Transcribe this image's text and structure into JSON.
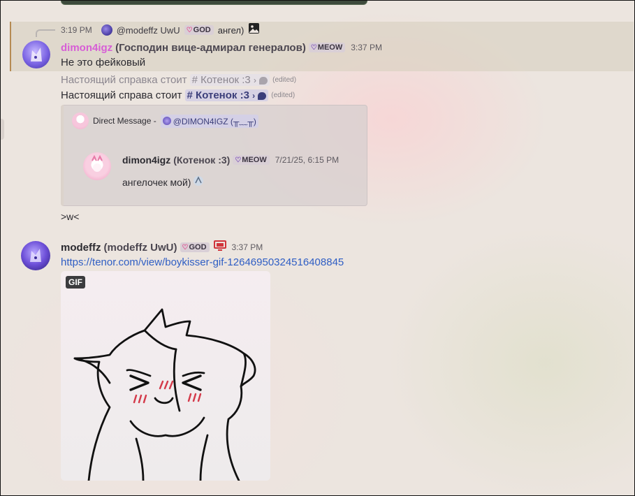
{
  "reply_header": {
    "time": "3:19 PM",
    "user": "@modeffz UwU",
    "badge": "GOD",
    "text": "ангел)",
    "image_icon": "image-icon"
  },
  "messages": {
    "dimon": {
      "username": "dimon4igz",
      "display": "(Господин вице-адмирал генералов)",
      "badge": "MEOW",
      "time": "3:37 PM",
      "text": "Не это фейковый",
      "username_color": "#d75ed6"
    },
    "edited_old": {
      "prefix": "Настоящий справка стоит",
      "channel": "Котенок :3",
      "chevron": "›",
      "edited": "(edited)"
    },
    "edited_new": {
      "prefix": "Настоящий справа стоит",
      "channel": "Котенок :3",
      "chevron": "›",
      "edited": "(edited)"
    },
    "forward": {
      "label": "Direct Message -",
      "mention": "@DIMON4IGZ (╥﹏╥)",
      "username": "dimon4igz",
      "display": "(Котенок :3)",
      "badge": "MEOW",
      "time": "7/21/25, 6:15 PM",
      "text": "ангелочек мой)"
    },
    "followup": {
      "text": ">w<"
    },
    "modeffz": {
      "username": "modeffz",
      "display": "(modeffz UwU)",
      "badge": "GOD",
      "device_icon": "monitor-icon",
      "time": "3:37 PM",
      "link": "https://tenor.com/view/boykisser-gif-12646950324516408845",
      "gif_badge": "GIF"
    }
  },
  "colors": {
    "accent_link": "#2f5ec4",
    "channel_text": "#3b3e7a",
    "highlight_bar": "#b58a52"
  }
}
